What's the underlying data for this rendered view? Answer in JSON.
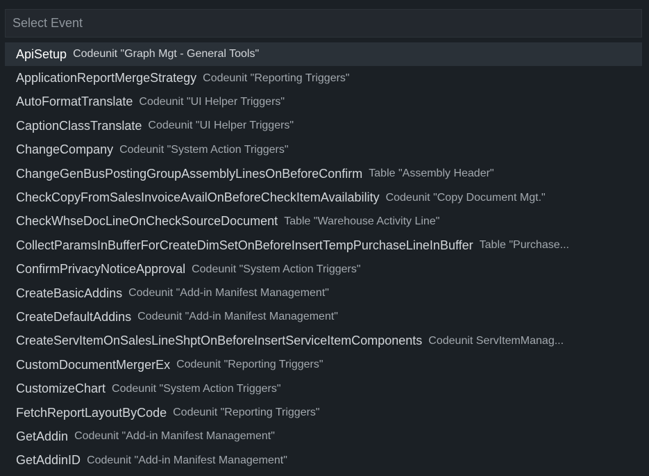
{
  "search": {
    "placeholder": "Select Event",
    "value": ""
  },
  "events": [
    {
      "name": "ApiSetup",
      "detail": "Codeunit \"Graph Mgt - General Tools\"",
      "selected": true
    },
    {
      "name": "ApplicationReportMergeStrategy",
      "detail": "Codeunit \"Reporting Triggers\""
    },
    {
      "name": "AutoFormatTranslate",
      "detail": "Codeunit \"UI Helper Triggers\""
    },
    {
      "name": "CaptionClassTranslate",
      "detail": "Codeunit \"UI Helper Triggers\""
    },
    {
      "name": "ChangeCompany",
      "detail": "Codeunit \"System Action Triggers\""
    },
    {
      "name": "ChangeGenBusPostingGroupAssemblyLinesOnBeforeConfirm",
      "detail": "Table \"Assembly Header\""
    },
    {
      "name": "CheckCopyFromSalesInvoiceAvailOnBeforeCheckItemAvailability",
      "detail": "Codeunit \"Copy Document Mgt.\""
    },
    {
      "name": "CheckWhseDocLineOnCheckSourceDocument",
      "detail": "Table \"Warehouse Activity Line\""
    },
    {
      "name": "CollectParamsInBufferForCreateDimSetOnBeforeInsertTempPurchaseLineInBuffer",
      "detail": "Table \"Purchase..."
    },
    {
      "name": "ConfirmPrivacyNoticeApproval",
      "detail": "Codeunit \"System Action Triggers\""
    },
    {
      "name": "CreateBasicAddins",
      "detail": "Codeunit \"Add-in Manifest Management\""
    },
    {
      "name": "CreateDefaultAddins",
      "detail": "Codeunit \"Add-in Manifest Management\""
    },
    {
      "name": "CreateServItemOnSalesLineShptOnBeforeInsertServiceItemComponents",
      "detail": "Codeunit ServItemManag..."
    },
    {
      "name": "CustomDocumentMergerEx",
      "detail": "Codeunit \"Reporting Triggers\""
    },
    {
      "name": "CustomizeChart",
      "detail": "Codeunit \"System Action Triggers\""
    },
    {
      "name": "FetchReportLayoutByCode",
      "detail": "Codeunit \"Reporting Triggers\""
    },
    {
      "name": "GetAddin",
      "detail": "Codeunit \"Add-in Manifest Management\""
    },
    {
      "name": "GetAddinID",
      "detail": "Codeunit \"Add-in Manifest Management\""
    }
  ]
}
